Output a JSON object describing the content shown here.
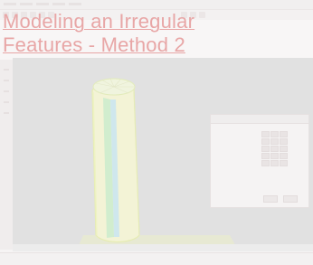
{
  "page": {
    "title_line1": "Modeling an Irregular",
    "title_line2": "Features - Method 2"
  },
  "dialog": {
    "title": "",
    "rows": [
      "",
      "",
      "",
      "",
      ""
    ]
  },
  "status": {
    "text": ""
  },
  "colors": {
    "title": "#e8a6a6",
    "viewport_bg": "#e1e1e1",
    "object_yellow": "#f2f2b8",
    "object_green": "#c9f2c9",
    "object_cyan": "#c4e8f2"
  }
}
